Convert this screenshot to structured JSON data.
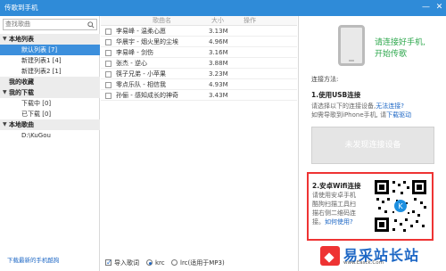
{
  "window": {
    "title": "传歌到手机",
    "minimize": "—",
    "close": "✕"
  },
  "search": {
    "placeholder": "查找歌曲"
  },
  "sidebar": {
    "local_list": "本地列表",
    "default_list": "默认列表 [7]",
    "new_list1": "新建列表1 [4]",
    "new_list2": "新建列表2 [1]",
    "my_favorites": "我的收藏",
    "my_downloads": "我的下载",
    "downloading": "下载中 [0]",
    "downloaded": "已下载 [0]",
    "local_songs": "本地歌曲",
    "local_path": "D:\\KuGou"
  },
  "left_bottom_link": "下载最新的手机酷狗",
  "table": {
    "headers": {
      "song": "歌曲名",
      "size": "大小",
      "action": "操作"
    },
    "rows": [
      {
        "name": "李易峰 - 温柔心愿",
        "size": "3.13M"
      },
      {
        "name": "华晨宇 - 烟火里的尘埃",
        "size": "4.96M"
      },
      {
        "name": "李易峰 - 剑伤",
        "size": "3.16M"
      },
      {
        "name": "张杰 - 逆心",
        "size": "3.88M"
      },
      {
        "name": "筷子兄弟 - 小苹果",
        "size": "3.23M"
      },
      {
        "name": "零点乐队 - 相信我",
        "size": "4.93M"
      },
      {
        "name": "孙俪 - 感知成长的神奇",
        "size": "3.43M"
      }
    ]
  },
  "footer": {
    "import_lyrics": "导入歌词",
    "krc": "krc",
    "lrc": "lrc(适用于MP3)"
  },
  "right": {
    "tip_line1": "请连接好手机,",
    "tip_line2": "开始传歌",
    "method_label": "连接方法:",
    "usb_title": "1.使用USB连接",
    "usb_line1_a": "请选择以下的连接设备,",
    "usb_line1_link": "无法连接?",
    "usb_line2_a": "如需导歌到iPhone手机, 请",
    "usb_line2_link": "下载驱动",
    "no_device_button": "未发现连接设备",
    "wifi_title": "2.安卓Wifi连接",
    "wifi_line1": "请使用安卓手机",
    "wifi_line2": "酷狗扫描工具扫",
    "wifi_line3": "描右侧二维码连",
    "wifi_line4": "接。",
    "wifi_link": "如何使用?"
  },
  "watermark": {
    "text": "易采站长站",
    "url": "www.Easck.Com"
  },
  "colors": {
    "title_bar": "#2f8bd8",
    "selection": "#3c8fdc",
    "accent_green": "#2fa84e",
    "link": "#1d67c5",
    "highlight_border": "#ee3333"
  }
}
